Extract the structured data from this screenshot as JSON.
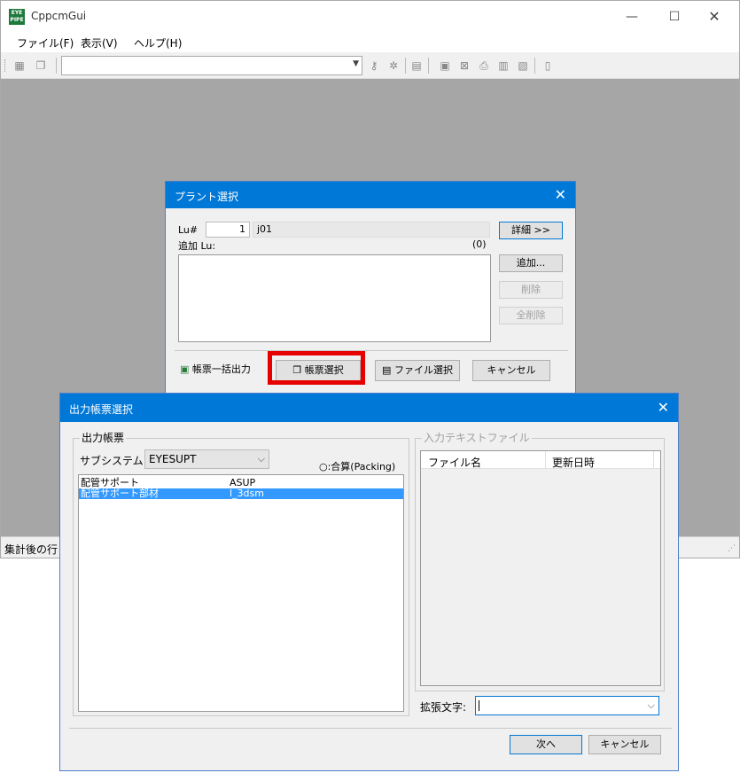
{
  "window": {
    "title": "CppcmGui",
    "icon_text": "EYE PIPE",
    "minimize": "—",
    "maximize": "☐",
    "close": "✕"
  },
  "menu": [
    "ファイル(F)",
    "表示(V)",
    "ヘルプ(H)"
  ],
  "toolbar": {
    "combo_value": ""
  },
  "status_bar": {
    "text": "集計後の行"
  },
  "plant_dialog": {
    "title": "プラント選択",
    "lu_label": "Lu#",
    "lu_value": "1",
    "lu_name": "j01",
    "detail_button": "詳細 >>",
    "add_lu_label": "追加 Lu:",
    "add_lu_count": "(0)",
    "add_button": "追加...",
    "delete_button": "削除",
    "delete_all_button": "全削除",
    "batch_output_button": "帳票一括出力",
    "report_select_button": "帳票選択",
    "file_select_button": "ファイル選択",
    "cancel_button": "キャンセル"
  },
  "report_dialog": {
    "title": "出力帳票選択",
    "report_group_label": "出力帳票",
    "subsystem_label": "サブシステム:",
    "subsystem_value": "EYESUPT",
    "packing_label": "○:合算(Packing)",
    "report_rows": [
      {
        "name": "配管サポート",
        "code": "ASUP",
        "selected": false
      },
      {
        "name": "配管サポート部材",
        "code": "l_3dsm",
        "selected": true
      }
    ],
    "input_group_label": "入力テキストファイル",
    "file_columns": [
      "ファイル名",
      "更新日時"
    ],
    "ext_label": "拡張文字:",
    "ext_value": "",
    "next_button": "次へ",
    "cancel_button": "キャンセル"
  },
  "colors": {
    "title_active": "#0078d7",
    "highlight": "#e60000",
    "selection": "#3399ff",
    "mdi_background": "#a6a6a6"
  }
}
